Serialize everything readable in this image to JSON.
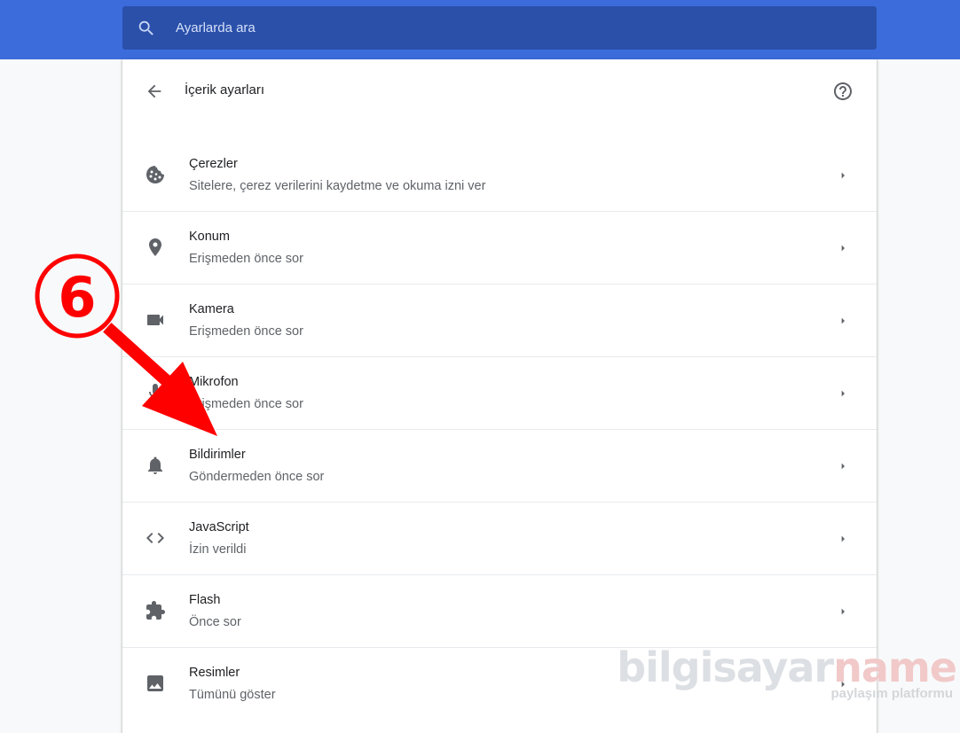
{
  "search": {
    "placeholder": "Ayarlarda ara"
  },
  "header": {
    "title": "İçerik ayarları"
  },
  "items": [
    {
      "title": "Çerezler",
      "subtitle": "Sitelere, çerez verilerini kaydetme ve okuma izni ver",
      "icon": "cookie-icon"
    },
    {
      "title": "Konum",
      "subtitle": "Erişmeden önce sor",
      "icon": "location-pin-icon"
    },
    {
      "title": "Kamera",
      "subtitle": "Erişmeden önce sor",
      "icon": "videocam-icon"
    },
    {
      "title": "Mikrofon",
      "subtitle": "Erişmeden önce sor",
      "icon": "mic-icon"
    },
    {
      "title": "Bildirimler",
      "subtitle": "Göndermeden önce sor",
      "icon": "bell-icon"
    },
    {
      "title": "JavaScript",
      "subtitle": "İzin verildi",
      "icon": "code-icon"
    },
    {
      "title": "Flash",
      "subtitle": "Önce sor",
      "icon": "puzzle-icon"
    },
    {
      "title": "Resimler",
      "subtitle": "Tümünü göster",
      "icon": "image-icon"
    }
  ],
  "annotation": {
    "step_label": "6"
  },
  "watermark": {
    "main_a": "bilgisayar",
    "main_b": "name",
    "sub": "paylaşım platformu"
  },
  "colors": {
    "topbar": "#3c6cdc",
    "search_bg": "#2a50aa",
    "annotation": "#ff0000",
    "icon": "#5f6368"
  }
}
